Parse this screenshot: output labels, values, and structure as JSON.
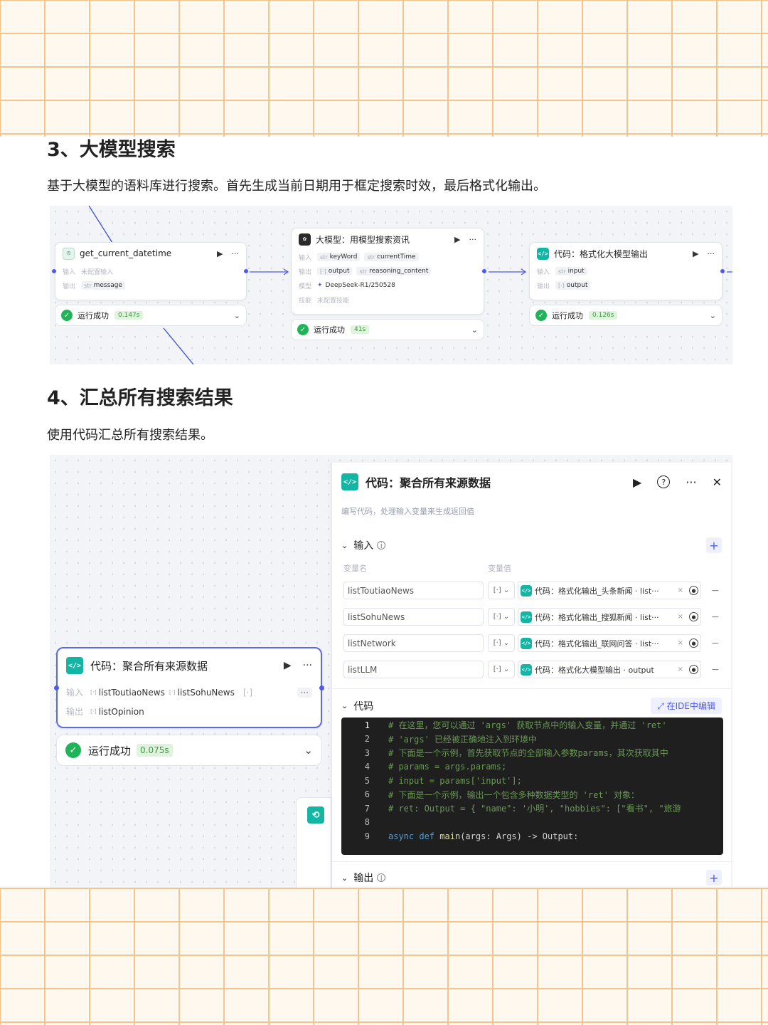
{
  "section3": {
    "heading": "3、大模型搜索",
    "desc": "基于大模型的语料库进行搜索。首先生成当前日期用于框定搜索时效，最后格式化输出。",
    "nodes": [
      {
        "title": "get_current_datetime",
        "rows": [
          {
            "label": "输入",
            "values": [
              "未配置输入"
            ]
          },
          {
            "label": "输出",
            "values": [
              {
                "type": "str",
                "name": "message"
              }
            ]
          }
        ],
        "status": "运行成功",
        "time": "0.147s"
      },
      {
        "title": "大模型：用模型搜索资讯",
        "rows": [
          {
            "label": "输入",
            "values": [
              {
                "type": "str",
                "name": "keyWord"
              },
              {
                "type": "str",
                "name": "currentTime"
              }
            ]
          },
          {
            "label": "输出",
            "values": [
              {
                "type": "[·]",
                "name": "output"
              },
              {
                "type": "str",
                "name": "reasoning_content"
              }
            ]
          },
          {
            "label": "模型",
            "values": [
              "DeepSeek-R1/250528"
            ]
          },
          {
            "label": "技能",
            "values": [
              "未配置技能"
            ]
          }
        ],
        "status": "运行成功",
        "time": "41s"
      },
      {
        "title": "代码：格式化大模型输出",
        "rows": [
          {
            "label": "输入",
            "values": [
              {
                "type": "str",
                "name": "input"
              }
            ]
          },
          {
            "label": "输出",
            "values": [
              {
                "type": "[·]",
                "name": "output"
              }
            ]
          }
        ],
        "status": "运行成功",
        "time": "0.126s"
      }
    ]
  },
  "section4": {
    "heading": "4、汇总所有搜索结果",
    "desc": "使用代码汇总所有搜索结果。",
    "node": {
      "title": "代码：聚合所有来源数据",
      "input_label": "输入",
      "output_label": "输出",
      "inputs": [
        "listToutiaoNews",
        "listSohuNews"
      ],
      "outputs": [
        "listOpinion"
      ],
      "status": "运行成功",
      "time": "0.075s"
    },
    "panel": {
      "title": "代码：聚合所有来源数据",
      "subtitle": "编写代码，处理输入变量来生成返回值",
      "input_section": "输入",
      "col_name": "变量名",
      "col_value": "变量值",
      "vars": [
        {
          "name": "listToutiaoNews",
          "type": "[·]",
          "value": "代码：格式化输出_头条新闻 · list···"
        },
        {
          "name": "listSohuNews",
          "type": "[·]",
          "value": "代码：格式化输出_搜狐新闻 · list···"
        },
        {
          "name": "listNetwork",
          "type": "[·]",
          "value": "代码：格式化输出_联网问答 · list···"
        },
        {
          "name": "listLLM",
          "type": "[·]",
          "value": "代码：格式化大模型输出 · output"
        }
      ],
      "code_section": "代码",
      "ide_button": "在IDE中编辑",
      "code_lines": [
        {
          "n": "1",
          "text": "# 在这里，您可以通过 'args'  获取节点中的输入变量，并通过 'ret'"
        },
        {
          "n": "2",
          "text": "# 'args' 已经被正确地注入到环境中"
        },
        {
          "n": "3",
          "text": "# 下面是一个示例，首先获取节点的全部输入参数params，其次获取其中"
        },
        {
          "n": "4",
          "text": "# params = args.params;"
        },
        {
          "n": "5",
          "text": "# input = params['input'];"
        },
        {
          "n": "6",
          "text": "# 下面是一个示例，输出一个包含多种数据类型的 'ret' 对象："
        },
        {
          "n": "7",
          "text": "# ret: Output =  { \"name\": '小明', \"hobbies\": [\"看书\", \"旅游"
        },
        {
          "n": "8",
          "text": ""
        },
        {
          "n": "9",
          "text": "async def main(args: Args) -> Output:"
        }
      ],
      "output_section": "输出"
    }
  }
}
